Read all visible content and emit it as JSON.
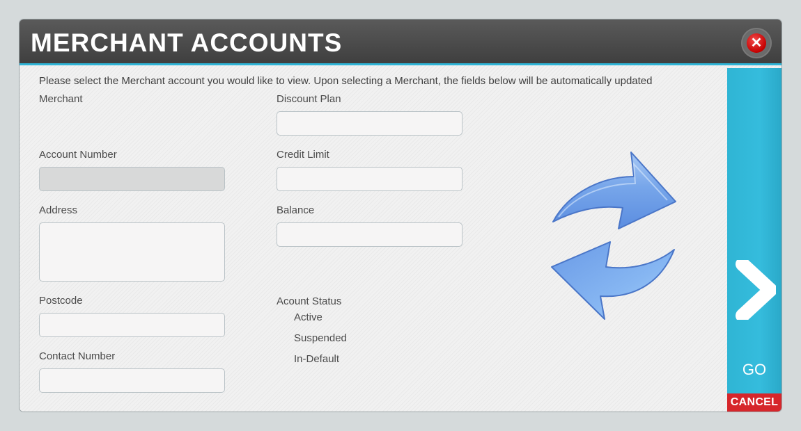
{
  "header": {
    "title": "MERCHANT ACCOUNTS",
    "close_icon": "close-icon",
    "close_symbol": "✕"
  },
  "intro_text": "Please select the Merchant account you would like to view.  Upon selecting a Merchant, the fields below will be automatically updated",
  "left_fields": {
    "merchant_label": "Merchant",
    "account_number_label": "Account Number",
    "account_number_value": "",
    "address_label": "Address",
    "address_value": "",
    "postcode_label": "Postcode",
    "postcode_value": "",
    "contact_number_label": "Contact Number",
    "contact_number_value": ""
  },
  "right_fields": {
    "discount_plan_label": "Discount Plan",
    "discount_plan_value": "",
    "credit_limit_label": "Credit Limit",
    "credit_limit_value": "",
    "balance_label": "Balance",
    "balance_value": ""
  },
  "account_status": {
    "label": "Acount Status",
    "options": [
      "Active",
      "Suspended",
      "In-Default"
    ]
  },
  "graphic": {
    "icon": "refresh-arrows-icon"
  },
  "actions": {
    "go_label": "GO",
    "go_icon": "chevron-right-icon",
    "cancel_label": "CANCEL"
  },
  "colors": {
    "header_bg": "#4a4a4a",
    "accent": "#2fb4d6",
    "cancel": "#d6262b",
    "close": "#c50000",
    "arrow_blue": "#6b9fe6"
  }
}
